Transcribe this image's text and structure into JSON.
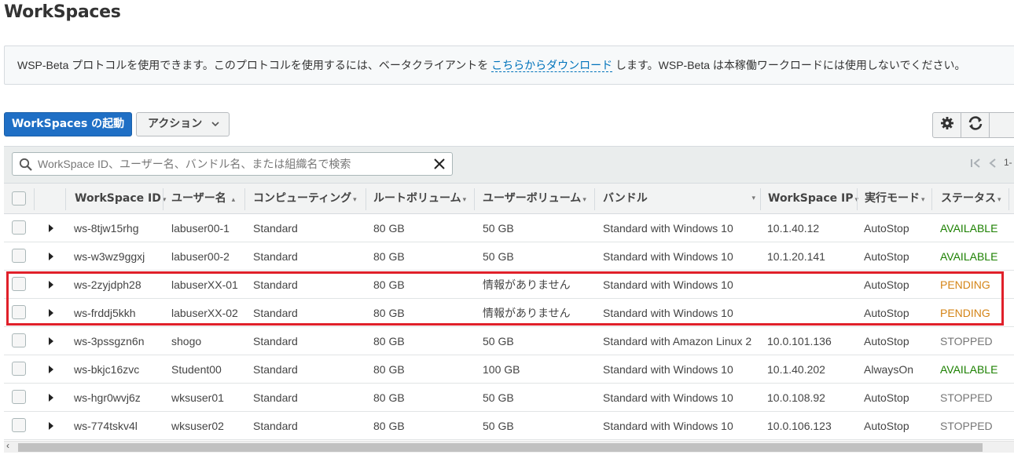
{
  "page": {
    "title": "WorkSpaces"
  },
  "banner": {
    "text_before": "WSP-Beta プロトコルを使用できます。このプロトコルを使用するには、ベータクライアントを ",
    "link": "こちらからダウンロード",
    "text_after": " します。WSP-Beta は本稼働ワークロードには使用しないでください。"
  },
  "toolbar": {
    "launch_label": "WorkSpaces の起動",
    "actions_label": "アクション",
    "settings_icon": "gear-icon",
    "refresh_icon": "refresh-icon"
  },
  "search": {
    "placeholder": "WorkSpace ID、ユーザー名、バンドル名、または組織名で検索"
  },
  "pager": {
    "first_icon": "first-page-icon",
    "prev_icon": "prev-page-icon",
    "text": "1-"
  },
  "columns": [
    {
      "key": "id",
      "label": "WorkSpace ID",
      "sort": "▾"
    },
    {
      "key": "user",
      "label": "ユーザー名",
      "sort": "▴"
    },
    {
      "key": "compute",
      "label": "コンピューティング",
      "sort": "▾"
    },
    {
      "key": "root",
      "label": "ルートボリューム",
      "sort": "▾"
    },
    {
      "key": "uservol",
      "label": "ユーザーボリューム",
      "sort": "▾"
    },
    {
      "key": "bundle",
      "label": "バンドル",
      "sort": "▾"
    },
    {
      "key": "ip",
      "label": "WorkSpace IP",
      "sort": "▾"
    },
    {
      "key": "mode",
      "label": "実行モード",
      "sort": "▾"
    },
    {
      "key": "status",
      "label": "ステータス",
      "sort": "▾"
    }
  ],
  "rows": [
    {
      "id": "ws-8tjw15rhg",
      "user": "labuser00-1",
      "compute": "Standard",
      "root": "80 GB",
      "uservol": "50 GB",
      "bundle": "Standard with Windows 10",
      "ip": "10.1.40.12",
      "mode": "AutoStop",
      "status": "AVAILABLE"
    },
    {
      "id": "ws-w3wz9ggxj",
      "user": "labuser00-2",
      "compute": "Standard",
      "root": "80 GB",
      "uservol": "50 GB",
      "bundle": "Standard with Windows 10",
      "ip": "10.1.20.141",
      "mode": "AutoStop",
      "status": "AVAILABLE"
    },
    {
      "id": "ws-2zyjdph28",
      "user": "labuserXX-01",
      "compute": "Standard",
      "root": "80 GB",
      "uservol": "情報がありません",
      "bundle": "Standard with Windows 10",
      "ip": "",
      "mode": "AutoStop",
      "status": "PENDING"
    },
    {
      "id": "ws-frddj5kkh",
      "user": "labuserXX-02",
      "compute": "Standard",
      "root": "80 GB",
      "uservol": "情報がありません",
      "bundle": "Standard with Windows 10",
      "ip": "",
      "mode": "AutoStop",
      "status": "PENDING"
    },
    {
      "id": "ws-3pssgzn6n",
      "user": "shogo",
      "compute": "Standard",
      "root": "80 GB",
      "uservol": "50 GB",
      "bundle": "Standard with Amazon Linux 2",
      "ip": "10.0.101.136",
      "mode": "AutoStop",
      "status": "STOPPED"
    },
    {
      "id": "ws-bkjc16zvc",
      "user": "Student00",
      "compute": "Standard",
      "root": "80 GB",
      "uservol": "100 GB",
      "bundle": "Standard with Windows 10",
      "ip": "10.1.40.202",
      "mode": "AlwaysOn",
      "status": "AVAILABLE"
    },
    {
      "id": "ws-hgr0wvj6z",
      "user": "wksuser01",
      "compute": "Standard",
      "root": "80 GB",
      "uservol": "50 GB",
      "bundle": "Standard with Windows 10",
      "ip": "10.0.108.92",
      "mode": "AutoStop",
      "status": "STOPPED"
    },
    {
      "id": "ws-774tskv4l",
      "user": "wksuser02",
      "compute": "Standard",
      "root": "80 GB",
      "uservol": "50 GB",
      "bundle": "Standard with Windows 10",
      "ip": "10.0.106.123",
      "mode": "AutoStop",
      "status": "STOPPED"
    }
  ],
  "colors": {
    "available": "#1d8102",
    "pending": "#d48416",
    "stopped": "#777777",
    "primary": "#1f6fc5",
    "highlight": "#e0202a"
  }
}
